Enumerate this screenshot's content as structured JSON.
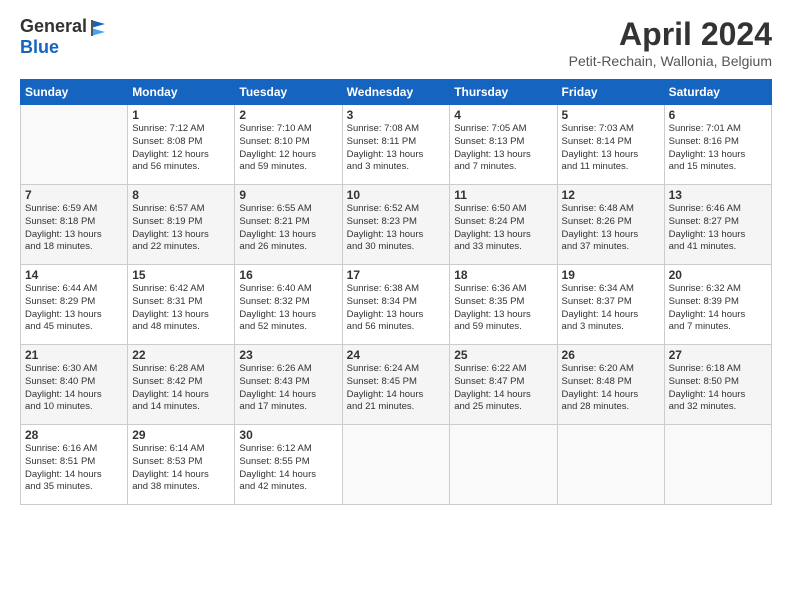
{
  "header": {
    "logo_general": "General",
    "logo_blue": "Blue",
    "title": "April 2024",
    "location": "Petit-Rechain, Wallonia, Belgium"
  },
  "weekdays": [
    "Sunday",
    "Monday",
    "Tuesday",
    "Wednesday",
    "Thursday",
    "Friday",
    "Saturday"
  ],
  "weeks": [
    [
      {
        "day": "",
        "info": ""
      },
      {
        "day": "1",
        "info": "Sunrise: 7:12 AM\nSunset: 8:08 PM\nDaylight: 12 hours\nand 56 minutes."
      },
      {
        "day": "2",
        "info": "Sunrise: 7:10 AM\nSunset: 8:10 PM\nDaylight: 12 hours\nand 59 minutes."
      },
      {
        "day": "3",
        "info": "Sunrise: 7:08 AM\nSunset: 8:11 PM\nDaylight: 13 hours\nand 3 minutes."
      },
      {
        "day": "4",
        "info": "Sunrise: 7:05 AM\nSunset: 8:13 PM\nDaylight: 13 hours\nand 7 minutes."
      },
      {
        "day": "5",
        "info": "Sunrise: 7:03 AM\nSunset: 8:14 PM\nDaylight: 13 hours\nand 11 minutes."
      },
      {
        "day": "6",
        "info": "Sunrise: 7:01 AM\nSunset: 8:16 PM\nDaylight: 13 hours\nand 15 minutes."
      }
    ],
    [
      {
        "day": "7",
        "info": "Sunrise: 6:59 AM\nSunset: 8:18 PM\nDaylight: 13 hours\nand 18 minutes."
      },
      {
        "day": "8",
        "info": "Sunrise: 6:57 AM\nSunset: 8:19 PM\nDaylight: 13 hours\nand 22 minutes."
      },
      {
        "day": "9",
        "info": "Sunrise: 6:55 AM\nSunset: 8:21 PM\nDaylight: 13 hours\nand 26 minutes."
      },
      {
        "day": "10",
        "info": "Sunrise: 6:52 AM\nSunset: 8:23 PM\nDaylight: 13 hours\nand 30 minutes."
      },
      {
        "day": "11",
        "info": "Sunrise: 6:50 AM\nSunset: 8:24 PM\nDaylight: 13 hours\nand 33 minutes."
      },
      {
        "day": "12",
        "info": "Sunrise: 6:48 AM\nSunset: 8:26 PM\nDaylight: 13 hours\nand 37 minutes."
      },
      {
        "day": "13",
        "info": "Sunrise: 6:46 AM\nSunset: 8:27 PM\nDaylight: 13 hours\nand 41 minutes."
      }
    ],
    [
      {
        "day": "14",
        "info": "Sunrise: 6:44 AM\nSunset: 8:29 PM\nDaylight: 13 hours\nand 45 minutes."
      },
      {
        "day": "15",
        "info": "Sunrise: 6:42 AM\nSunset: 8:31 PM\nDaylight: 13 hours\nand 48 minutes."
      },
      {
        "day": "16",
        "info": "Sunrise: 6:40 AM\nSunset: 8:32 PM\nDaylight: 13 hours\nand 52 minutes."
      },
      {
        "day": "17",
        "info": "Sunrise: 6:38 AM\nSunset: 8:34 PM\nDaylight: 13 hours\nand 56 minutes."
      },
      {
        "day": "18",
        "info": "Sunrise: 6:36 AM\nSunset: 8:35 PM\nDaylight: 13 hours\nand 59 minutes."
      },
      {
        "day": "19",
        "info": "Sunrise: 6:34 AM\nSunset: 8:37 PM\nDaylight: 14 hours\nand 3 minutes."
      },
      {
        "day": "20",
        "info": "Sunrise: 6:32 AM\nSunset: 8:39 PM\nDaylight: 14 hours\nand 7 minutes."
      }
    ],
    [
      {
        "day": "21",
        "info": "Sunrise: 6:30 AM\nSunset: 8:40 PM\nDaylight: 14 hours\nand 10 minutes."
      },
      {
        "day": "22",
        "info": "Sunrise: 6:28 AM\nSunset: 8:42 PM\nDaylight: 14 hours\nand 14 minutes."
      },
      {
        "day": "23",
        "info": "Sunrise: 6:26 AM\nSunset: 8:43 PM\nDaylight: 14 hours\nand 17 minutes."
      },
      {
        "day": "24",
        "info": "Sunrise: 6:24 AM\nSunset: 8:45 PM\nDaylight: 14 hours\nand 21 minutes."
      },
      {
        "day": "25",
        "info": "Sunrise: 6:22 AM\nSunset: 8:47 PM\nDaylight: 14 hours\nand 25 minutes."
      },
      {
        "day": "26",
        "info": "Sunrise: 6:20 AM\nSunset: 8:48 PM\nDaylight: 14 hours\nand 28 minutes."
      },
      {
        "day": "27",
        "info": "Sunrise: 6:18 AM\nSunset: 8:50 PM\nDaylight: 14 hours\nand 32 minutes."
      }
    ],
    [
      {
        "day": "28",
        "info": "Sunrise: 6:16 AM\nSunset: 8:51 PM\nDaylight: 14 hours\nand 35 minutes."
      },
      {
        "day": "29",
        "info": "Sunrise: 6:14 AM\nSunset: 8:53 PM\nDaylight: 14 hours\nand 38 minutes."
      },
      {
        "day": "30",
        "info": "Sunrise: 6:12 AM\nSunset: 8:55 PM\nDaylight: 14 hours\nand 42 minutes."
      },
      {
        "day": "",
        "info": ""
      },
      {
        "day": "",
        "info": ""
      },
      {
        "day": "",
        "info": ""
      },
      {
        "day": "",
        "info": ""
      }
    ]
  ]
}
